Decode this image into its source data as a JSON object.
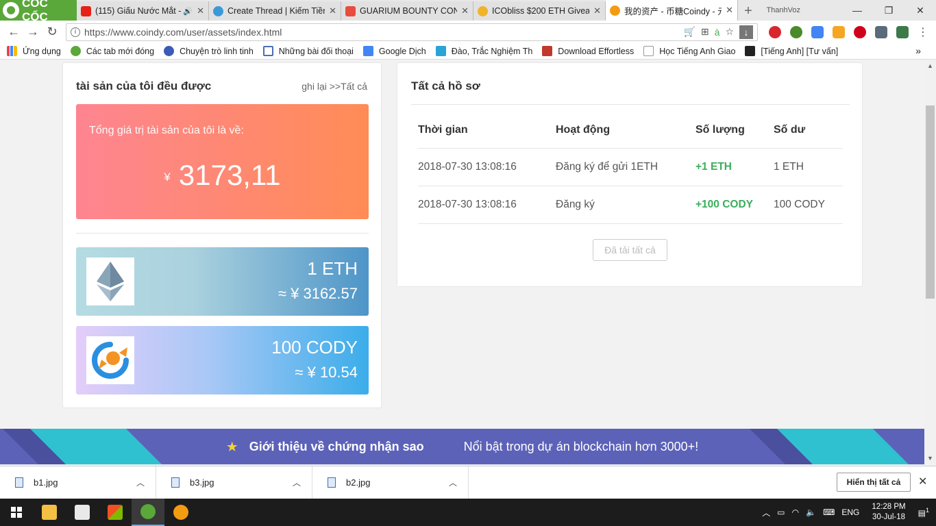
{
  "browser": {
    "brand": "CỐC CỐC",
    "tabs": [
      {
        "label": "(115) Giấu Nước Mắt -",
        "color": "#e62117",
        "extra": "🔊"
      },
      {
        "label": "Create Thread | Kiếm Tiền",
        "color": "#3a9ad9"
      },
      {
        "label": "GUARIUM BOUNTY CONT",
        "color": "#e84c3d"
      },
      {
        "label": "ICObliss $200 ETH Giveaw",
        "color": "#f0b429"
      },
      {
        "label": "我的资产 - 币糖Coindy - 元",
        "color": "#f39c12"
      }
    ],
    "user": "ThanhVoz",
    "url": "https://www.coindy.com/user/assets/index.html",
    "bookmarks": [
      {
        "label": "Ứng dụng",
        "color": "#e44"
      },
      {
        "label": "Các tab mới đóng",
        "color": "#5aa73a"
      },
      {
        "label": "Chuyện trò linh tinh",
        "color": "#3b5bb8"
      },
      {
        "label": "Những bài đối thoại",
        "color": "#4a6fb5"
      },
      {
        "label": "Google Dịch",
        "color": "#4285f4"
      },
      {
        "label": "Đào, Trắc Nghiệm Th",
        "color": "#2aa3d6"
      },
      {
        "label": "Download Effortless",
        "color": "#c0392b"
      },
      {
        "label": "Học Tiếng Anh Giao",
        "color": "#999"
      },
      {
        "label": "[Tiếng Anh] [Tư vấn]",
        "color": "#222"
      }
    ]
  },
  "assets": {
    "title": "tài sản của tôi đều được",
    "link": "ghi lại >>Tất cả",
    "total_label": "Tổng giá trị tài sản của tôi là về:",
    "currency": "¥",
    "total_value": "3173,11",
    "coins": [
      {
        "amount": "1 ETH",
        "approx": "≈ ¥  3162.57",
        "icon": "ethereum-icon"
      },
      {
        "amount": "100 CODY",
        "approx": "≈ ¥  10.54",
        "icon": "cody-candy-icon"
      }
    ]
  },
  "records": {
    "title": "Tất cả hồ sơ",
    "columns": [
      "Thời gian",
      "Hoạt động",
      "Số lượng",
      "Số dư"
    ],
    "rows": [
      [
        "2018-07-30 13:08:16",
        "Đăng ký để gửi 1ETH",
        "+1 ETH",
        "1 ETH"
      ],
      [
        "2018-07-30 13:08:16",
        "Đăng ký",
        "+100 CODY",
        "100 CODY"
      ]
    ],
    "loaded_label": "Đã tải tất cả"
  },
  "banner": {
    "title": "Giới thiệu về chứng nhận sao",
    "subtitle": "Nổi bật trong dự án blockchain hơn 3000+!"
  },
  "downloads": {
    "files": [
      "b1.jpg",
      "b3.jpg",
      "b2.jpg"
    ],
    "show_all": "Hiển thị tất cả"
  },
  "taskbar": {
    "lang": "ENG",
    "time": "12:28 PM",
    "date": "30-Jul-18",
    "notifications": "1"
  }
}
